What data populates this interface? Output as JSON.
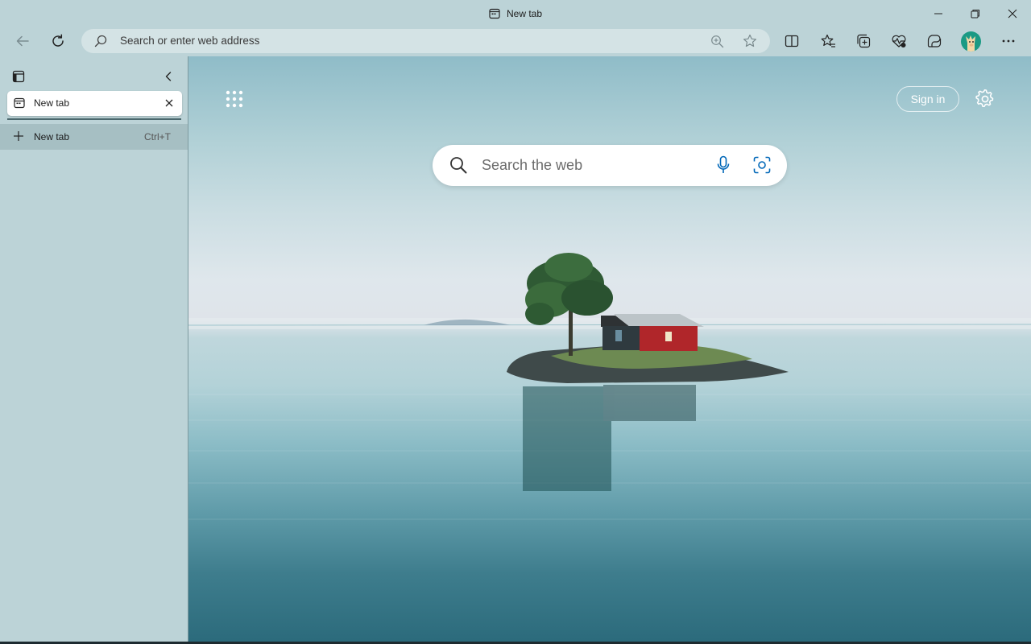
{
  "window": {
    "title": "New tab"
  },
  "toolbar": {
    "address_placeholder": "Search or enter web address"
  },
  "sidebar": {
    "active_tab_label": "New tab",
    "new_tab_label": "New tab",
    "new_tab_shortcut": "Ctrl+T"
  },
  "page": {
    "signin_label": "Sign in",
    "search_placeholder": "Search the web"
  },
  "icons": {
    "back": "back-arrow-icon",
    "refresh": "refresh-icon",
    "search": "search-icon",
    "zoom": "zoom-in-icon",
    "favorite": "star-icon",
    "split": "split-screen-icon",
    "favorites": "favorites-icon",
    "collections": "collections-icon",
    "browser-essentials": "heart-pulse-icon",
    "copilot": "copilot-icon",
    "more": "more-icon",
    "apps": "app-launcher-icon",
    "settings": "gear-icon",
    "microphone": "microphone-icon",
    "visual-search": "visual-search-icon"
  },
  "colors": {
    "chrome_bg": "#bcd3d7",
    "address_bg": "#d4e3e5",
    "accent": "#0067b8",
    "sidebar_hover": "#a6bfc3"
  }
}
